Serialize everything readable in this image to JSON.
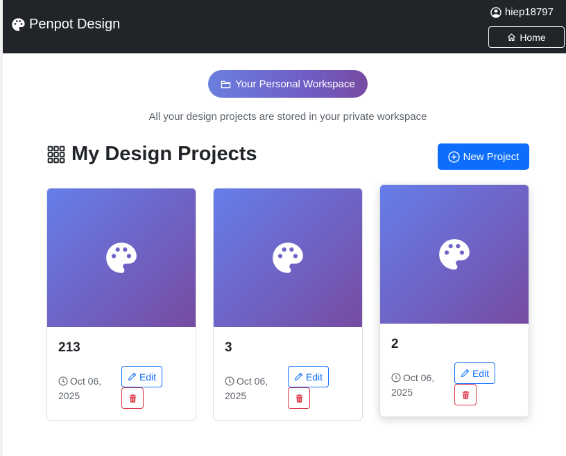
{
  "navbar": {
    "brand": "Penpot Design",
    "username": "hiep18797",
    "home_label": "Home"
  },
  "workspace": {
    "badge_label": "Your Personal Workspace",
    "subtitle": "All your design projects are stored in your private workspace"
  },
  "projects_section": {
    "title": "My Design Projects",
    "new_button_label": "New Project"
  },
  "projects": [
    {
      "name": "213",
      "date": "Oct 06, 2025",
      "edit_label": "Edit"
    },
    {
      "name": "3",
      "date": "Oct 06, 2025",
      "edit_label": "Edit"
    },
    {
      "name": "2",
      "date": "Oct 06, 2025",
      "edit_label": "Edit"
    }
  ],
  "icons": {
    "brand": "palette-icon",
    "user": "person-circle-icon",
    "home": "house-icon",
    "workspace": "folder-icon",
    "section": "grid-icon",
    "new": "plus-circle-icon",
    "thumbnail": "palette-icon",
    "date": "clock-icon",
    "edit": "pencil-icon",
    "delete": "trash-icon"
  },
  "colors": {
    "navbar": "#212529",
    "primary": "#0d6efd",
    "danger": "#dc3545",
    "gradient_start": "#667eea",
    "gradient_end": "#764ba2"
  }
}
